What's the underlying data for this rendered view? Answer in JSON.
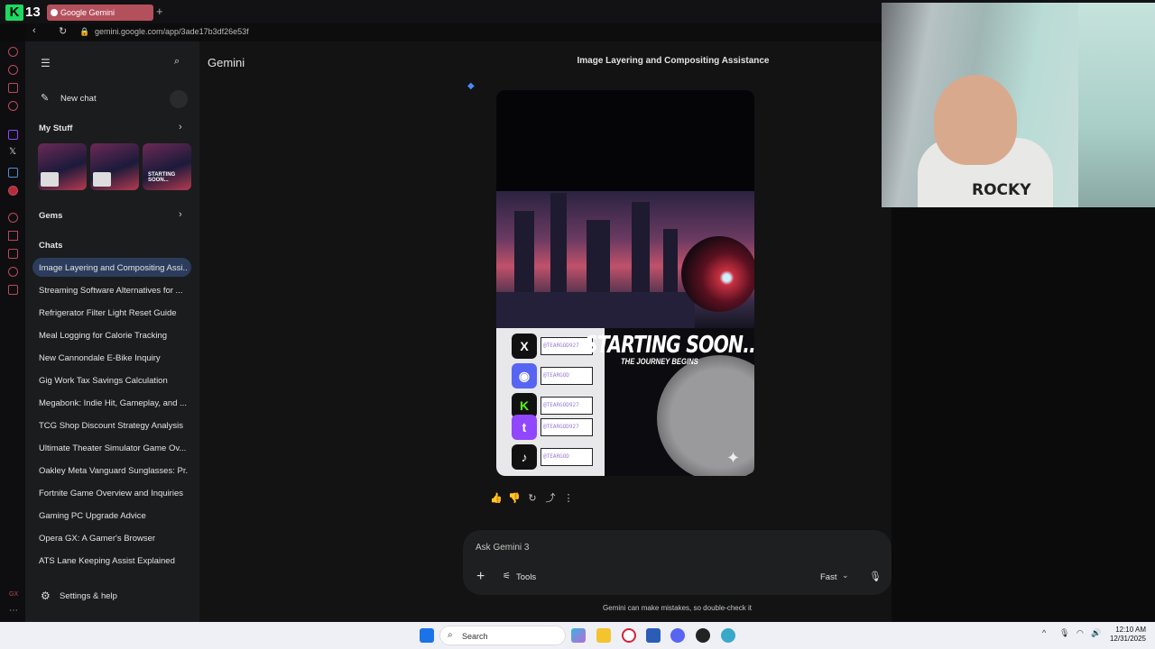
{
  "browser": {
    "tab_count": "13",
    "tab_title": "Google Gemini",
    "new_tab": "+",
    "url": "gemini.google.com/app/3ade17b3df26e53f"
  },
  "sidebar": {
    "new_chat": "New chat",
    "my_stuff": "My Stuff",
    "gems": "Gems",
    "chats_heading": "Chats",
    "chats": [
      "Image Layering and Compositing Assi...",
      "Streaming Software Alternatives for ...",
      "Refrigerator Filter Light Reset Guide",
      "Meal Logging for Calorie Tracking",
      "New Cannondale E-Bike Inquiry",
      "Gig Work Tax Savings Calculation",
      "Megabonk: Indie Hit, Gameplay, and ...",
      "TCG Shop Discount Strategy Analysis",
      "Ultimate Theater Simulator Game Ov...",
      "Oakley Meta Vanguard Sunglasses: Pr...",
      "Fortnite Game Overview and Inquiries",
      "Gaming PC Upgrade Advice",
      "Opera GX: A Gamer's Browser",
      "ATS Lane Keeping Assist Explained"
    ],
    "settings": "Settings & help",
    "gx_label": "GX",
    "thumb_caption": "STARTING SOON..."
  },
  "main": {
    "app_name": "Gemini",
    "conversation_title": "Image Layering and Compositing Assistance",
    "poster": {
      "starting": "STARTING SOON...",
      "journey": "THE JOURNEY BEGINS",
      "handles": [
        "@TEARGOD927",
        "@TEARGOD",
        "@TEARGOD927",
        "@TEARGOD927",
        "@TEARGOD"
      ],
      "social_icons": [
        "x-icon",
        "discord-icon",
        "kick-icon",
        "twitch-icon",
        "tiktok-icon"
      ]
    },
    "prompt_placeholder": "Ask Gemini 3",
    "tools_label": "Tools",
    "mode_label": "Fast",
    "disclaimer": "Gemini can make mistakes, so double-check it"
  },
  "webcam": {
    "shirt_text": "ROCKY"
  },
  "taskbar": {
    "search": "Search",
    "time": "12:10 AM",
    "date": "12/31/2025"
  },
  "colors": {
    "accent": "#2c3c5c",
    "gx_green": "#1ed760",
    "tab": "#b4505c"
  }
}
